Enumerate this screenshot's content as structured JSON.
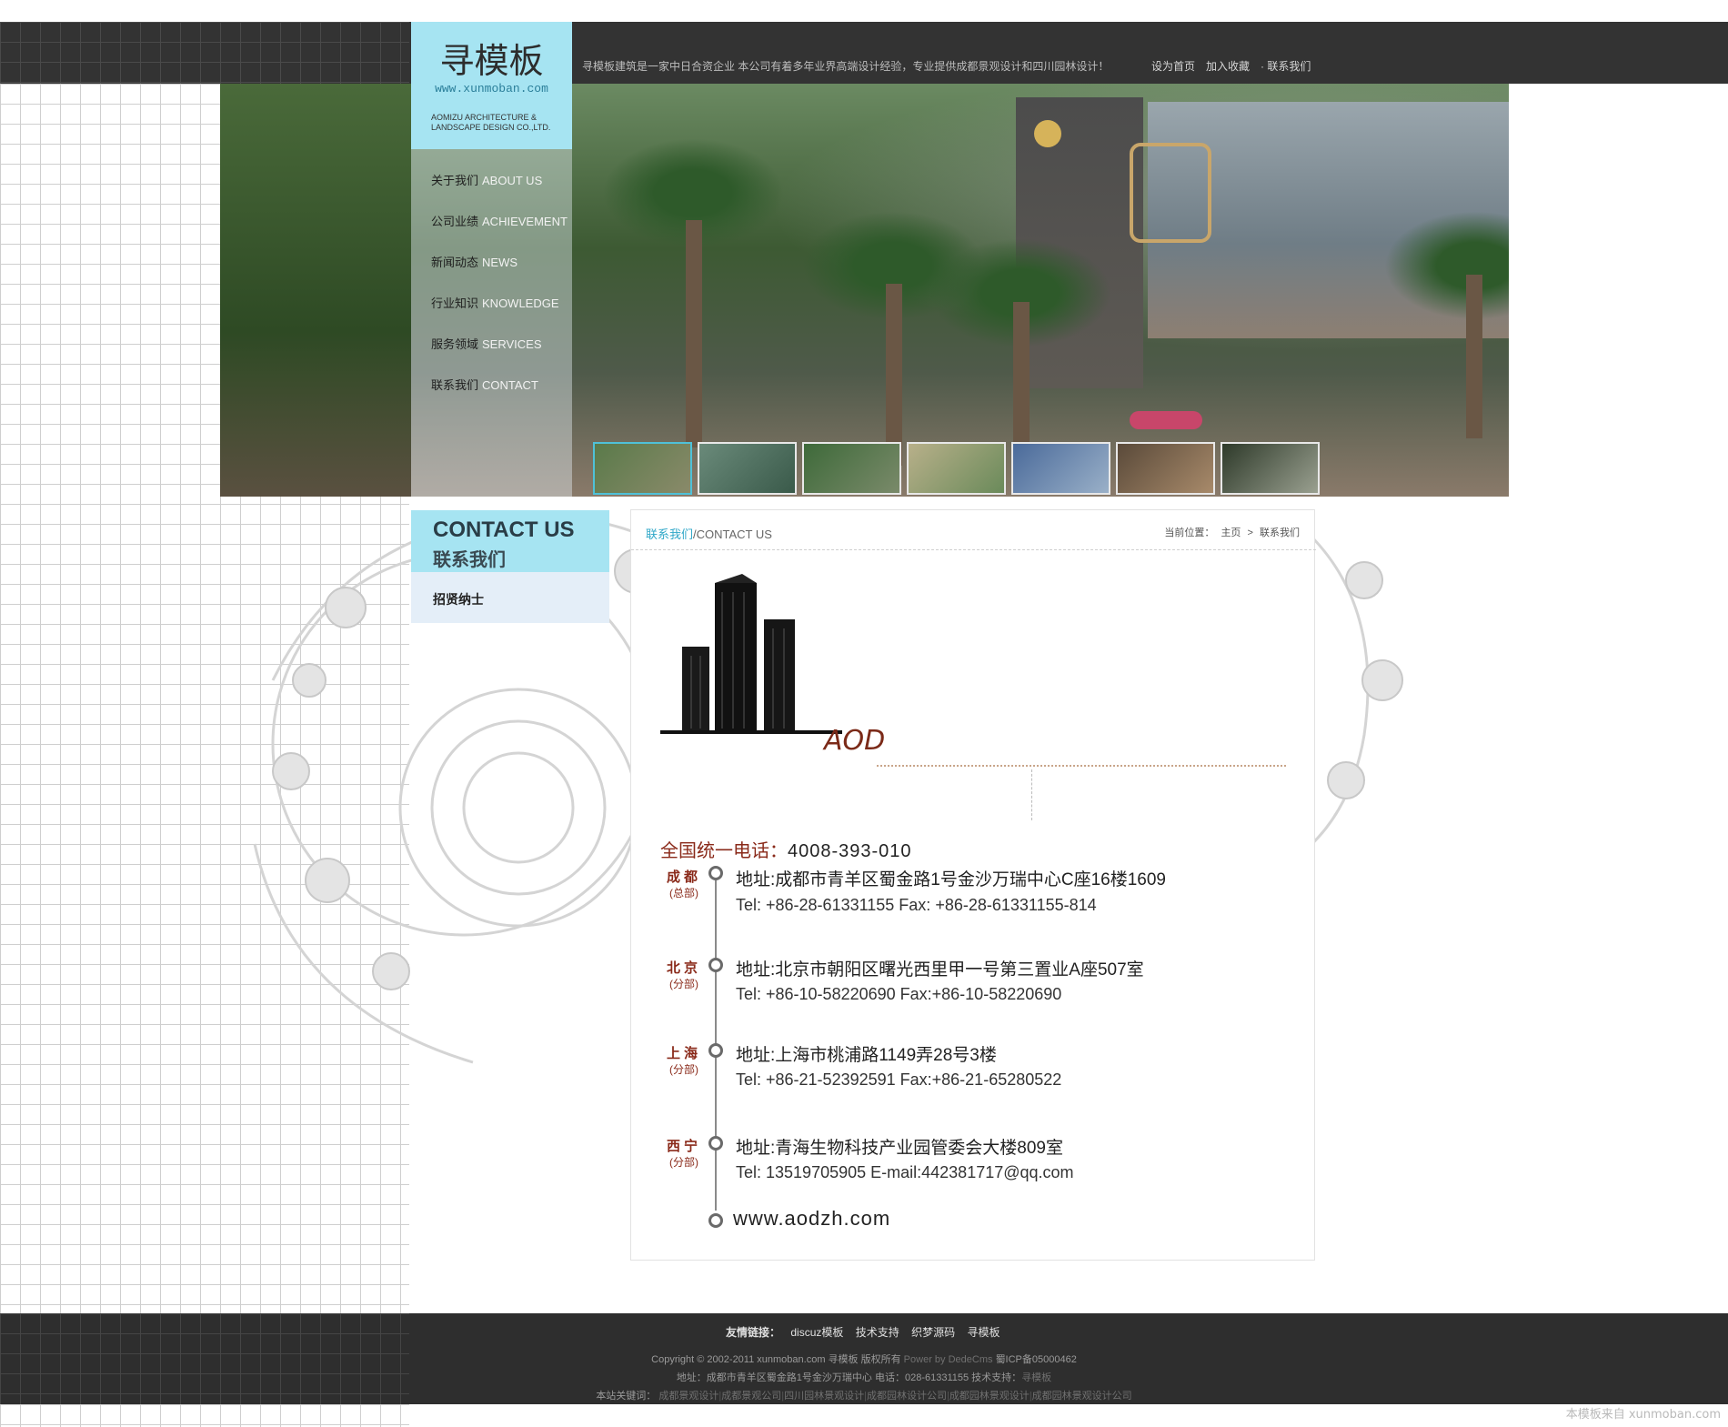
{
  "header": {
    "logo_title": "寻模板",
    "logo_url": "www.xunmoban.com",
    "company_name_en": "AOMIZU ARCHITECTURE & LANDSCAPE DESIGN CO.,LTD.",
    "intro": "寻模板建筑是一家中日合资企业 本公司有着多年业界高端设计经验，专业提供成都景观设计和四川园林设计！",
    "links": [
      "设为首页",
      "加入收藏",
      "· 联系我们"
    ]
  },
  "nav": [
    {
      "cn": "关于我们",
      "en": "ABOUT US"
    },
    {
      "cn": "公司业绩",
      "en": "ACHIEVEMENT"
    },
    {
      "cn": "新闻动态",
      "en": "NEWS"
    },
    {
      "cn": "行业知识",
      "en": "KNOWLEDGE"
    },
    {
      "cn": "服务领域",
      "en": "SERVICES"
    },
    {
      "cn": "联系我们",
      "en": "CONTACT"
    }
  ],
  "sidebar": {
    "title_en": "CONTACT US",
    "title_cn": "联系我们",
    "items": [
      "招贤纳士"
    ]
  },
  "content": {
    "title_cn": "联系我们",
    "title_en": "/CONTACT US",
    "breadcrumb": {
      "label": "当前位置：",
      "home": "主页",
      "sep": ">",
      "current": "联系我们"
    },
    "logo_text": "AOD",
    "hotline_label": "全国统一电话：",
    "hotline_number": "4008-393-010",
    "offices": [
      {
        "city": "成都",
        "type": "(总部)",
        "address": "地址:成都市青羊区蜀金路1号金沙万瑞中心C座16楼1609",
        "contact": "Tel: +86-28-61331155  Fax: +86-28-61331155-814"
      },
      {
        "city": "北京",
        "type": "(分部)",
        "address": "地址:北京市朝阳区曙光西里甲一号第三置业A座507室",
        "contact": "Tel: +86-10-58220690  Fax:+86-10-58220690"
      },
      {
        "city": "上海",
        "type": "(分部)",
        "address": "地址:上海市桃浦路1149弄28号3楼",
        "contact": "Tel: +86-21-52392591  Fax:+86-21-65280522"
      },
      {
        "city": "西宁",
        "type": "(分部)",
        "address": "地址:青海生物科技产业园管委会大楼809室",
        "contact": "Tel: 13519705905  E-mail:442381717@qq.com"
      }
    ],
    "website": "www.aodzh.com"
  },
  "footer": {
    "friend_label": "友情链接：",
    "friend_links": [
      "discuz模板",
      "技术支持",
      "织梦源码",
      "寻模板"
    ],
    "copyright": "Copyright © 2002-2011 xunmoban.com 寻模板 版权所有",
    "powered": "Power by DedeCms",
    "icp": "蜀ICP备05000462",
    "address_line": "地址：成都市青羊区蜀金路1号金沙万瑞中心 电话：028-61331155 技术支持：",
    "support_link": "寻模板",
    "keywords_label": "本站关键词：",
    "keywords": [
      "成都景观设计",
      "成都景观公司",
      "四川园林景观设计",
      "成都园林设计公司",
      "成都园林景观设计",
      "成都园林景观设计公司"
    ],
    "watermark": "本模板来自 xunmoban.com"
  },
  "colors": {
    "accent_cyan": "#a6e4f2",
    "bar_dark": "#333333",
    "brand_red": "#8a2a1a",
    "link_blue": "#2fa7c8"
  }
}
